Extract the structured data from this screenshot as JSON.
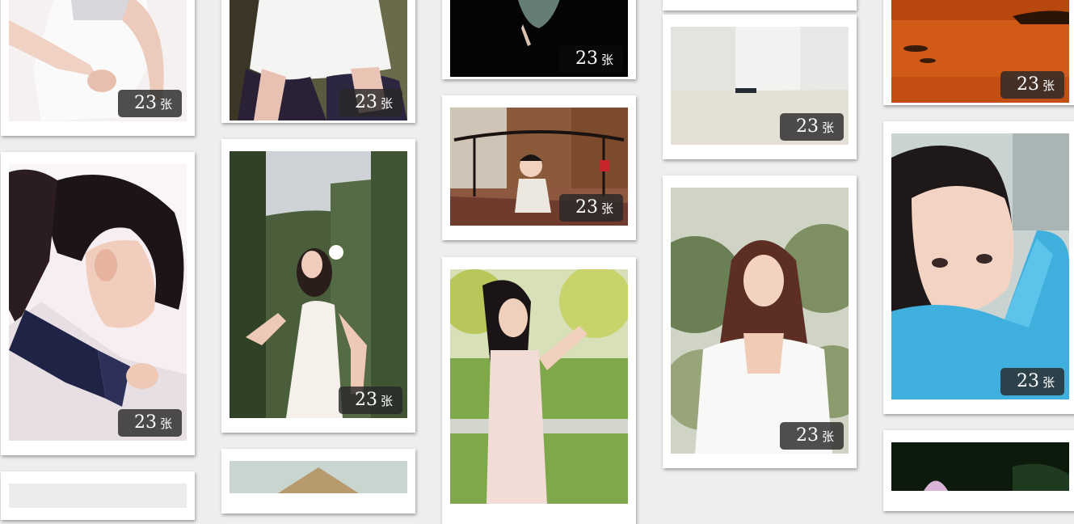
{
  "photo_count": "23",
  "unit": "张",
  "cards": [
    {
      "id": "c1",
      "scene": "wedding-dress-closeup"
    },
    {
      "id": "c2",
      "scene": "white-dress-seated"
    },
    {
      "id": "c3",
      "scene": "dark-underwater"
    },
    {
      "id": "c4",
      "scene": "empty-white-room"
    },
    {
      "id": "c5",
      "scene": "orange-sunset-sea"
    },
    {
      "id": "c6",
      "scene": "sailor-uniform-girl"
    },
    {
      "id": "c7",
      "scene": "hedge-maze-white-dress"
    },
    {
      "id": "c8",
      "scene": "child-on-iron-bed"
    },
    {
      "id": "c9",
      "scene": "girl-in-pink-dress-park"
    },
    {
      "id": "c10",
      "scene": "girl-white-blouse-bokeh"
    },
    {
      "id": "c11",
      "scene": "girl-blue-hoodie"
    },
    {
      "id": "c12",
      "scene": "house-roof"
    },
    {
      "id": "c13",
      "scene": "dark-flower"
    }
  ]
}
